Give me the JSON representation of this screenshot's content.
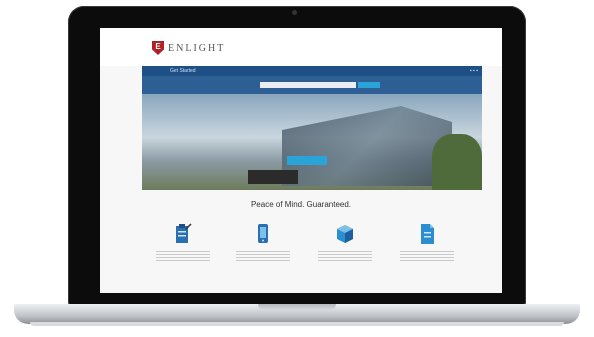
{
  "site": {
    "logo_letter": "E",
    "brand": "ENLIGHT",
    "nav_items": [
      "Get Started"
    ],
    "hero_headline": "",
    "hero_button": "",
    "section_title": "Peace of Mind. Guaranteed."
  },
  "features": [
    {
      "icon": "clipboard-icon",
      "label": ""
    },
    {
      "icon": "phone-icon",
      "label": ""
    },
    {
      "icon": "cube-icon",
      "label": ""
    },
    {
      "icon": "document-icon",
      "label": ""
    }
  ],
  "colors": {
    "brand_red": "#b21f24",
    "nav_blue": "#1e4f86",
    "accent_blue": "#2aa3d8"
  }
}
